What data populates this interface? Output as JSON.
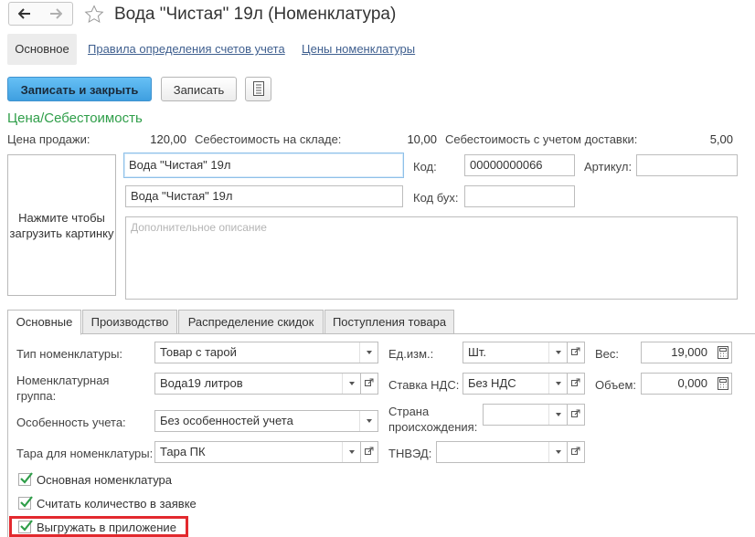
{
  "header": {
    "title": "Вода \"Чистая\" 19л (Номенклатура)",
    "back_icon": "arrow-left-icon",
    "forward_icon": "arrow-right-icon",
    "favorite_icon": "star-icon"
  },
  "top_tabs": {
    "main": "Основное",
    "account_rules": "Правила определения счетов учета",
    "prices": "Цены номенклатуры"
  },
  "toolbar": {
    "save_close": "Записать и закрыть",
    "save": "Записать",
    "report_icon": "report-icon"
  },
  "price_section": {
    "title": "Цена/Себестоимость",
    "sale_price_label": "Цена продажи:",
    "sale_price": "120,00",
    "cost_warehouse_label": "Себестоимость на складе:",
    "cost_warehouse": "10,00",
    "cost_delivery_label": "Себестоимость с учетом доставки:",
    "cost_delivery": "5,00"
  },
  "image_box": {
    "line1": "Нажмите чтобы",
    "line2": "загрузить картинку"
  },
  "fields": {
    "name": "Вода \"Чистая\" 19л",
    "full_name": "Вода \"Чистая\" 19л",
    "code_label": "Код:",
    "code": "00000000066",
    "article_label": "Артикул:",
    "article": "",
    "code_acc_label": "Код бух:",
    "code_acc": "",
    "description_placeholder": "Дополнительное описание"
  },
  "tabs": [
    "Основные",
    "Производство",
    "Распределение скидок",
    "Поступления товара"
  ],
  "main_tab": {
    "type_label": "Тип номенклатуры:",
    "type_value": "Товар с тарой",
    "group_label_1": "Номенклатурная",
    "group_label_2": "группа:",
    "group_value": "Вода19 литров",
    "feature_label": "Особенность учета:",
    "feature_value": "Без особенностей учета",
    "tare_label": "Тара для номенклатуры:",
    "tare_value": "Тара ПК",
    "unit_label": "Ед.изм.:",
    "unit_value": "Шт.",
    "vat_label": "Ставка НДС:",
    "vat_value": "Без НДС",
    "country_label_1": "Страна",
    "country_label_2": "происхождения:",
    "country_value": "",
    "tnved_label": "ТНВЭД:",
    "tnved_value": "",
    "weight_label": "Вес:",
    "weight_value": "19,000",
    "volume_label": "Объем:",
    "volume_value": "0,000"
  },
  "checkboxes": [
    {
      "label": "Основная номенклатура",
      "checked": true
    },
    {
      "label": "Считать количество в заявке",
      "checked": true
    },
    {
      "label": "Выгружать в приложение",
      "checked": true
    }
  ],
  "colors": {
    "accent_green": "#2f9e49",
    "primary_button": "#4aaef0",
    "highlight_red": "#e3292e"
  }
}
